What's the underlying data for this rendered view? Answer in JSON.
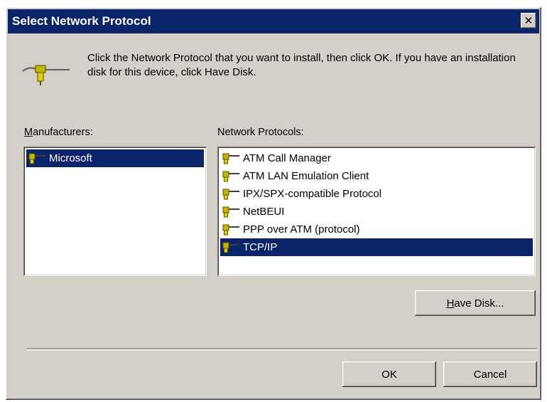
{
  "dialog": {
    "title": "Select Network Protocol",
    "close_glyph": "✕",
    "instructions": "Click the Network Protocol that you want to install, then click OK. If you have an installation disk for this device, click Have Disk."
  },
  "manufacturers": {
    "label_hotkey": "M",
    "label_rest": "anufacturers:",
    "items": [
      {
        "label": "Microsoft",
        "selected": true
      }
    ]
  },
  "protocols": {
    "label": "Network Protocols:",
    "items": [
      {
        "label": "ATM Call Manager",
        "selected": false
      },
      {
        "label": "ATM LAN Emulation Client",
        "selected": false
      },
      {
        "label": "IPX/SPX-compatible Protocol",
        "selected": false
      },
      {
        "label": "NetBEUI",
        "selected": false
      },
      {
        "label": "PPP over ATM (protocol)",
        "selected": false
      },
      {
        "label": "TCP/IP",
        "selected": true
      }
    ]
  },
  "buttons": {
    "have_disk_hotkey": "H",
    "have_disk_rest": "ave Disk...",
    "ok": "OK",
    "cancel": "Cancel"
  },
  "colors": {
    "titlebar": "#0a246a",
    "face": "#d4d0c8",
    "selection": "#0a246a"
  },
  "icons": {
    "header": "network-protocol-icon",
    "item": "protocol-plug-icon"
  }
}
